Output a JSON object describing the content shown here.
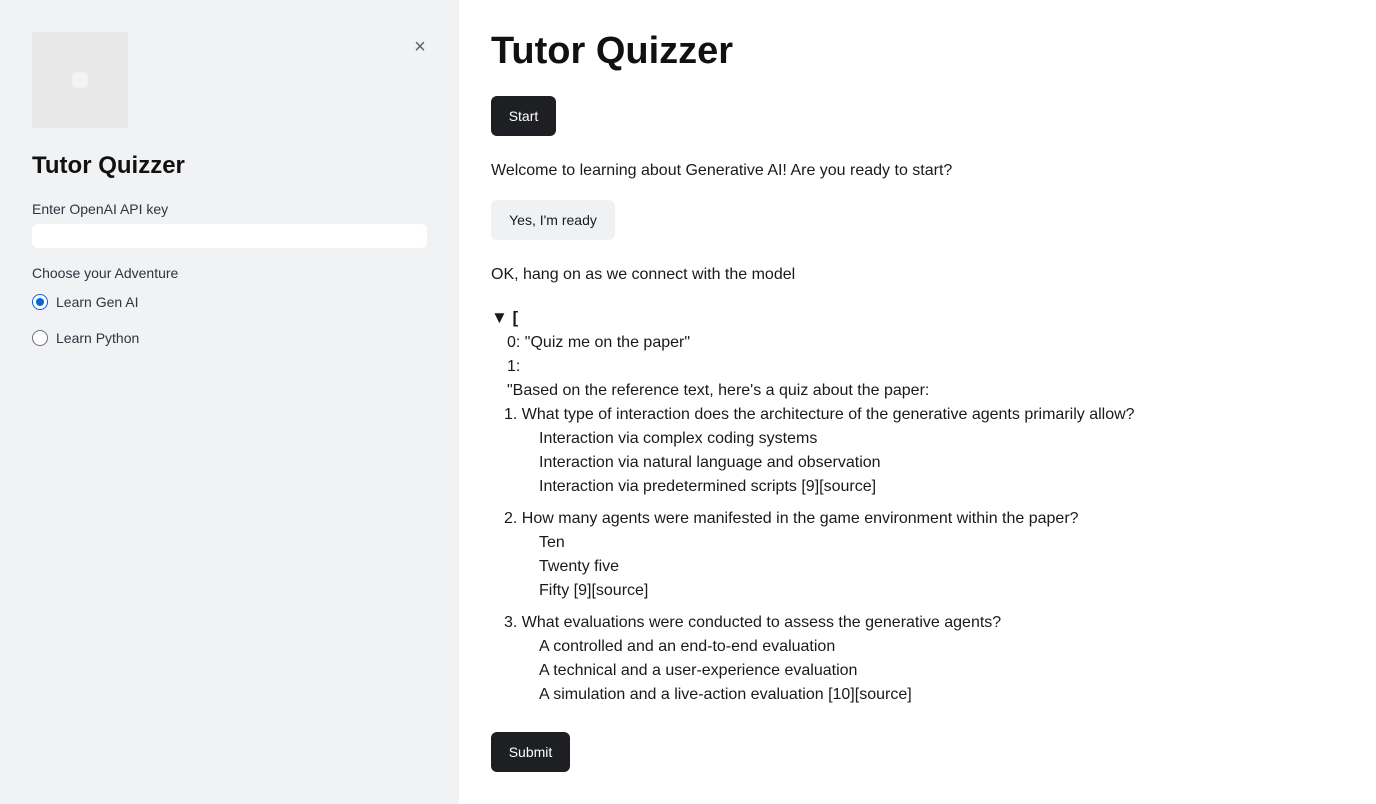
{
  "sidebar": {
    "title": "Tutor Quizzer",
    "close_label": "×",
    "api_key_label": "Enter OpenAI API key",
    "api_key_value": "",
    "adventure_label": "Choose your Adventure",
    "options": [
      {
        "label": "Learn Gen AI",
        "selected": true
      },
      {
        "label": "Learn Python",
        "selected": false
      }
    ]
  },
  "main": {
    "title": "Tutor Quizzer",
    "start_label": "Start",
    "welcome_text": "Welcome to learning about Generative AI! Are you ready to start?",
    "ready_label": "Yes, I'm ready",
    "connect_text": "OK, hang on as we connect with the model",
    "submit_label": "Submit"
  },
  "json_view": {
    "toggle": "▼ [",
    "item0": "0: \"Quiz me on the paper\"",
    "item1_key": "1:",
    "intro": "\"Based on the reference text, here's a quiz about the paper:",
    "questions": [
      {
        "question": "1. What type of interaction does the architecture of the generative agents primarily allow?",
        "options": [
          "Interaction via complex coding systems",
          "Interaction via natural language and observation",
          "Interaction via predetermined scripts [9][source]"
        ]
      },
      {
        "question": "2. How many agents were manifested in the game environment within the paper?",
        "options": [
          "Ten",
          "Twenty five",
          "Fifty [9][source]"
        ]
      },
      {
        "question": "3. What evaluations were conducted to assess the generative agents?",
        "options": [
          "A controlled and an end-to-end evaluation",
          "A technical and a user-experience evaluation",
          "A simulation and a live-action evaluation [10][source]"
        ]
      }
    ]
  },
  "colors": {
    "sidebar_bg": "#f1f2f4",
    "primary_button": "#1e1f22",
    "secondary_button": "#f0f1f3",
    "radio_accent": "#0a66d4"
  }
}
